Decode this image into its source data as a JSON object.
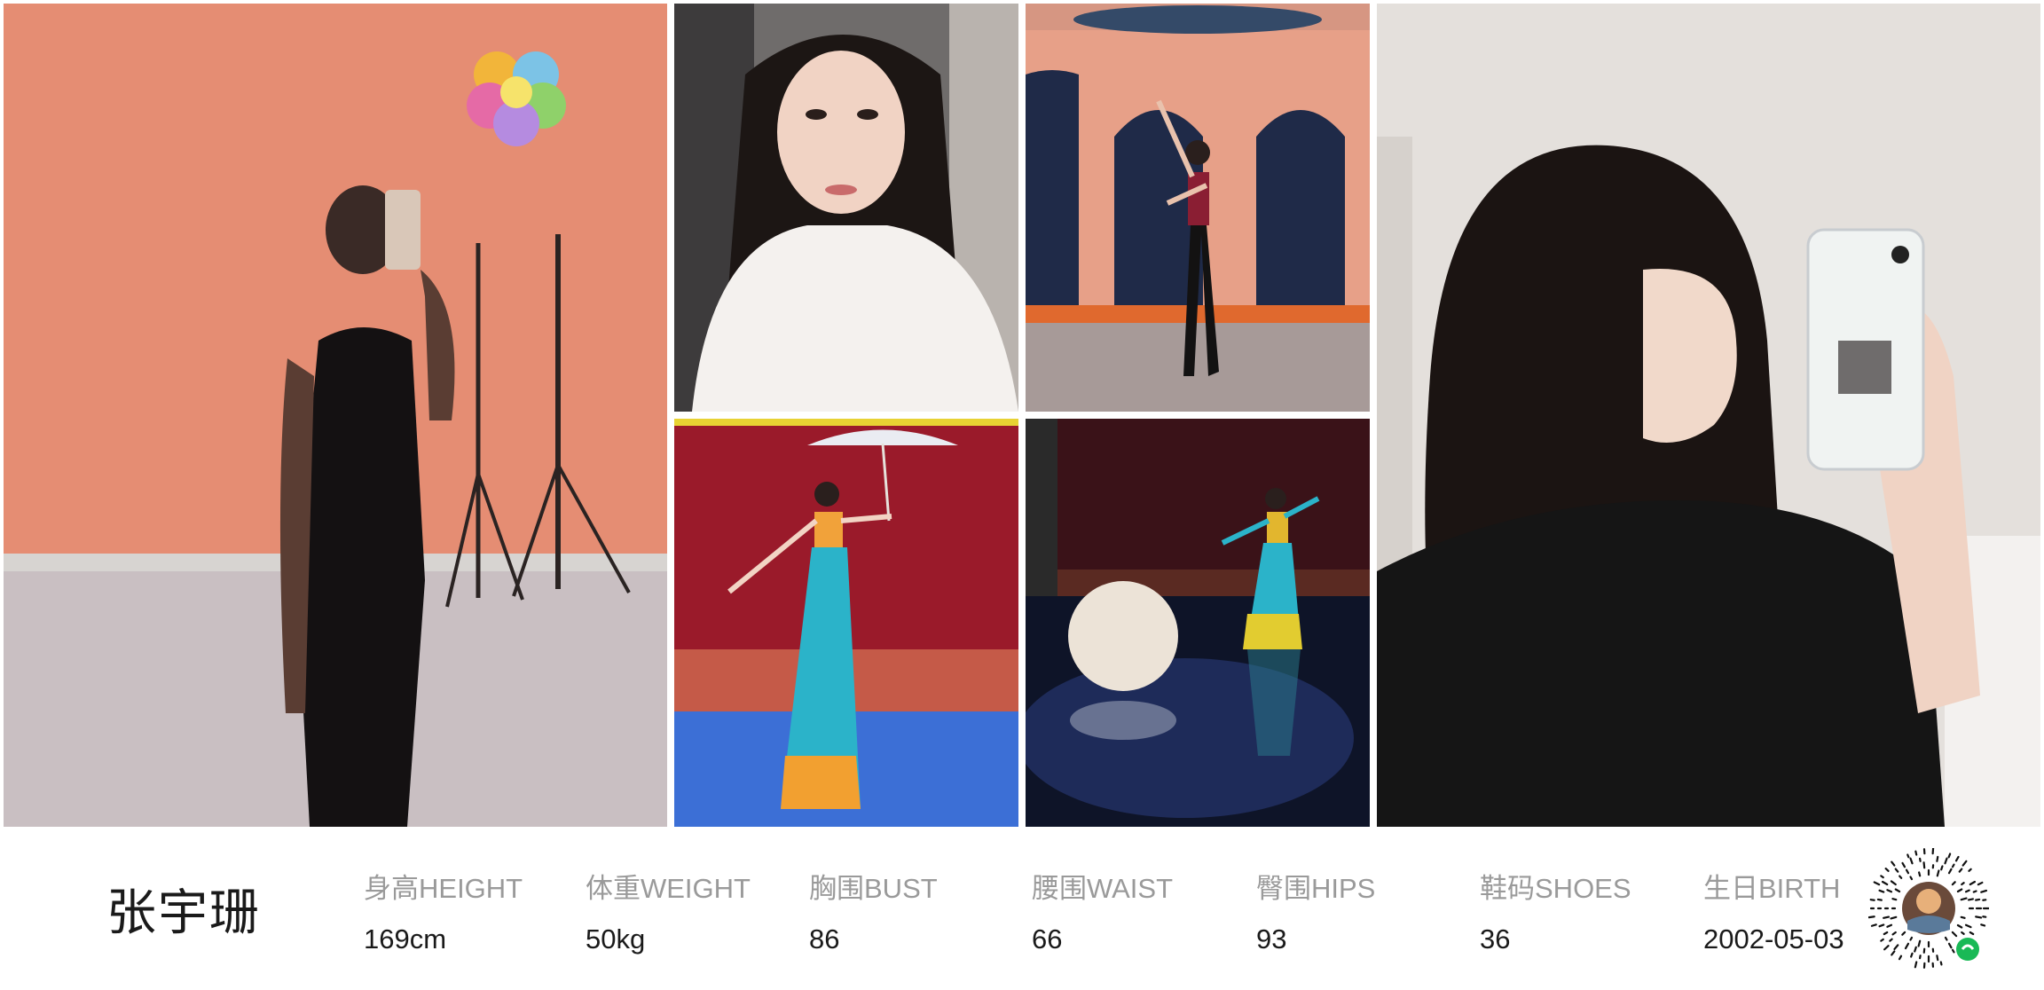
{
  "profile": {
    "name": "张宇珊"
  },
  "stats": [
    {
      "label": "身高HEIGHT",
      "value": "169cm"
    },
    {
      "label": "体重WEIGHT",
      "value": "50kg"
    },
    {
      "label": "胸围BUST",
      "value": "86"
    },
    {
      "label": "腰围WAIST",
      "value": "66"
    },
    {
      "label": "臀围HIPS",
      "value": "93"
    },
    {
      "label": "鞋码SHOES",
      "value": "36"
    },
    {
      "label": "生日BIRTH",
      "value": "2002-05-03"
    }
  ],
  "photos": [
    {
      "name": "mirror-selfie-dance-studio"
    },
    {
      "name": "portrait-selfie-white-sweater"
    },
    {
      "name": "ballet-pose-studio"
    },
    {
      "name": "stage-dance-umbrella"
    },
    {
      "name": "stage-dance-dark"
    },
    {
      "name": "mirror-selfie-profile"
    }
  ],
  "qr_code": {
    "icon": "mini-program-code-icon",
    "accent": "#19b956"
  }
}
